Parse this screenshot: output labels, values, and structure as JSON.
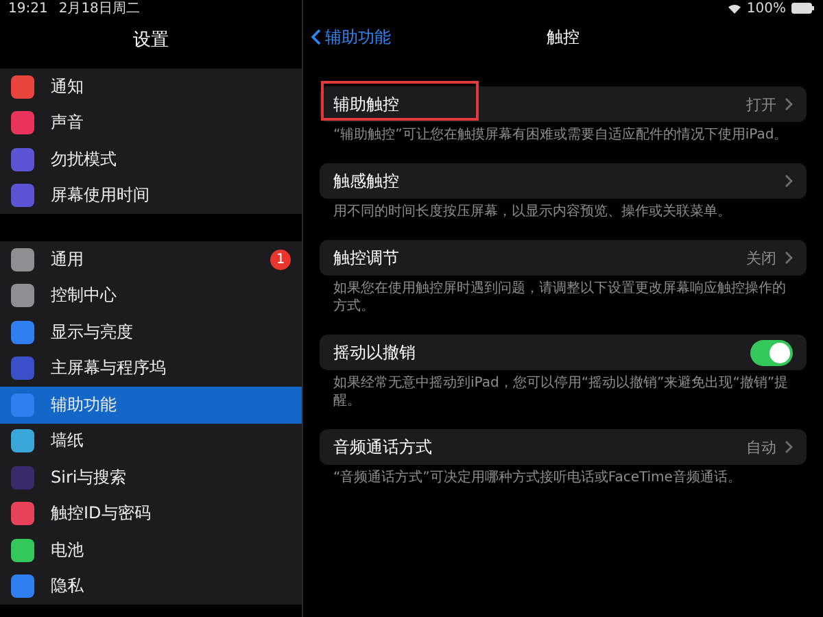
{
  "status_bar": {
    "time": "19:21",
    "date": "2月18日周二",
    "battery": "100%"
  },
  "sidebar": {
    "title": "设置",
    "groups": [
      [
        {
          "label": "通知",
          "color": "#e8453c",
          "selected": false
        },
        {
          "label": "声音",
          "color": "#e8335a",
          "selected": false
        },
        {
          "label": "勿扰模式",
          "color": "#5b55d6",
          "selected": false
        },
        {
          "label": "屏幕使用时间",
          "color": "#5b55d6",
          "selected": false
        }
      ],
      [
        {
          "label": "通用",
          "color": "#8e8e93",
          "selected": false,
          "badge": "1"
        },
        {
          "label": "控制中心",
          "color": "#8e8e93",
          "selected": false
        },
        {
          "label": "显示与亮度",
          "color": "#2f7ff0",
          "selected": false
        },
        {
          "label": "主屏幕与程序坞",
          "color": "#3a4fc8",
          "selected": false
        },
        {
          "label": "辅助功能",
          "color": "#2f7ff0",
          "selected": true
        },
        {
          "label": "墙纸",
          "color": "#39a8d8",
          "selected": false
        },
        {
          "label": "Siri与搜索",
          "color": "#3b2a6b",
          "selected": false
        },
        {
          "label": "触控ID与密码",
          "color": "#e8435a",
          "selected": false
        },
        {
          "label": "电池",
          "color": "#34c759",
          "selected": false
        },
        {
          "label": "隐私",
          "color": "#2f7ff0",
          "selected": false
        }
      ]
    ]
  },
  "nav": {
    "back": "辅助功能",
    "title": "触控"
  },
  "sections": [
    {
      "kind": "value",
      "label": "辅助触控",
      "value": "打开",
      "highlighted": true,
      "footer": "“辅助触控”可让您在触摸屏幕有困难或需要自适应配件的情况下使用iPad。"
    },
    {
      "kind": "chevron",
      "label": "触感触控",
      "highlighted": false,
      "footer": "用不同的时间长度按压屏幕，以显示内容预览、操作或关联菜单。"
    },
    {
      "kind": "value",
      "label": "触控调节",
      "value": "关闭",
      "highlighted": false,
      "footer": "如果您在使用触控屏时遇到问题，请调整以下设置更改屏幕响应触控操作的方式。"
    },
    {
      "kind": "toggle",
      "label": "摇动以撤销",
      "on": true,
      "highlighted": false,
      "footer": "如果经常无意中摇动到iPad，您可以停用“摇动以撤销”来避免出现“撤销”提醒。"
    },
    {
      "kind": "value",
      "label": "音频通话方式",
      "value": "自动",
      "highlighted": false,
      "footer": "“音频通话方式”可决定用哪种方式接听电话或FaceTime音频通话。"
    }
  ]
}
